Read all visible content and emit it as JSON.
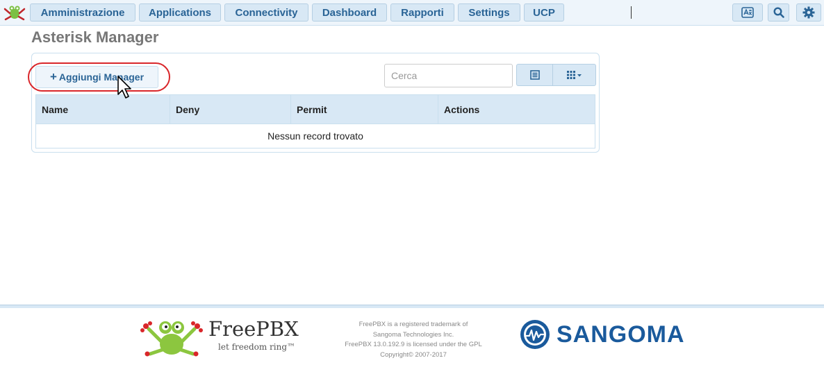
{
  "topnav": {
    "items": [
      {
        "label": "Amministrazione"
      },
      {
        "label": "Applications"
      },
      {
        "label": "Connectivity"
      },
      {
        "label": "Dashboard"
      },
      {
        "label": "Rapporti"
      },
      {
        "label": "Settings"
      },
      {
        "label": "UCP"
      }
    ],
    "icons": [
      "language-icon",
      "search-icon",
      "gear-icon"
    ]
  },
  "page": {
    "title": "Asterisk Manager"
  },
  "toolbar": {
    "add_label": "Aggiungi Manager",
    "search_placeholder": "Cerca",
    "view_icons": [
      "list-view-icon",
      "columns-grid-icon"
    ]
  },
  "table": {
    "columns": [
      "Name",
      "Deny",
      "Permit",
      "Actions"
    ],
    "empty_text": "Nessun record trovato"
  },
  "footer": {
    "brand": "FreePBX",
    "tagline": "let freedom ring™",
    "legal_lines": [
      "FreePBX is a registered trademark of",
      "Sangoma Technologies Inc.",
      "FreePBX 13.0.192.9 is licensed under the GPL",
      "Copyright© 2007-2017"
    ],
    "partner": "SANGOMA"
  },
  "colors": {
    "accent": "#2a6496",
    "nav_bg": "#d8e8f5",
    "highlight": "#d9262a",
    "sangoma_blue": "#1a5a9c"
  }
}
